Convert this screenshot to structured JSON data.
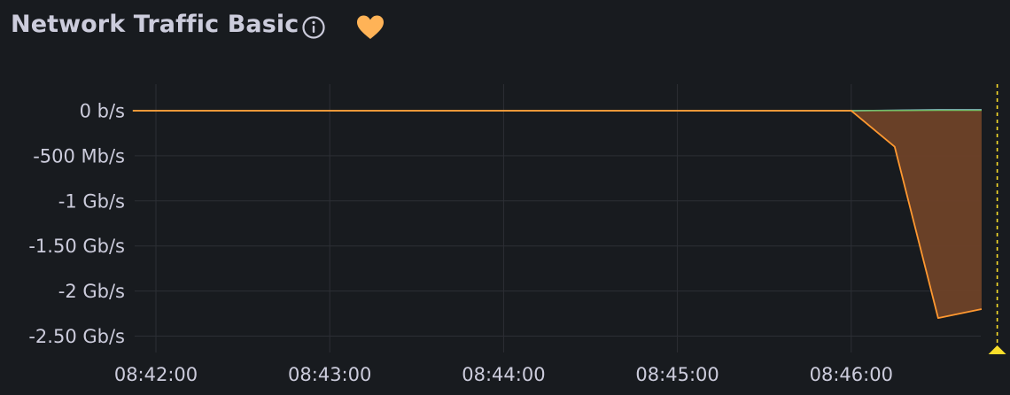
{
  "panel": {
    "title": "Network Traffic Basic",
    "info_icon": "info-circle-icon",
    "favorite_icon": "heart-icon"
  },
  "colors": {
    "background": "#181b1f",
    "text": "#ccccdc",
    "grid": "#2c2f35",
    "series_orange": "#ff9830",
    "series_orange_fill": "#6e4228",
    "series_blue": "#8ab8ff",
    "series_green": "#73bf69",
    "heart": "#ffb357",
    "annotation": "#fade2a"
  },
  "chart_data": {
    "type": "area",
    "title": "Network Traffic Basic",
    "xlabel": "",
    "ylabel": "",
    "x_ticks": [
      "08:42:00",
      "08:43:00",
      "08:44:00",
      "08:45:00",
      "08:46:00"
    ],
    "y_ticks": [
      {
        "value": 0,
        "label": "0 b/s"
      },
      {
        "value": -500,
        "label": "-500 Mb/s"
      },
      {
        "value": -1000,
        "label": "-1 Gb/s"
      },
      {
        "value": -1500,
        "label": "-1.50 Gb/s"
      },
      {
        "value": -2000,
        "label": "-2 Gb/s"
      },
      {
        "value": -2500,
        "label": "-2.50 Gb/s"
      }
    ],
    "x_range_minutes": [
      -0.133,
      4.798
    ],
    "ylim": [
      -2750,
      0
    ],
    "y_unit": "Mb/s",
    "grid": true,
    "series": [
      {
        "color": "#ff9830",
        "fill": true,
        "x_minutes": [
          -0.133,
          4.0,
          4.25,
          4.5,
          4.75
        ],
        "values": [
          0,
          0,
          -400,
          -2300,
          -2200
        ]
      },
      {
        "color": "#8ab8ff",
        "fill": false,
        "x_minutes": [
          -0.133,
          4.0,
          4.25,
          4.5,
          4.75
        ],
        "values": [
          0,
          0,
          5,
          10,
          10
        ]
      },
      {
        "color": "#73bf69",
        "fill": false,
        "x_minutes": [
          -0.133,
          4.0,
          4.25,
          4.5,
          4.75
        ],
        "values": [
          0,
          0,
          3,
          6,
          6
        ]
      }
    ],
    "annotation": {
      "x_minutes": 4.84
    }
  }
}
